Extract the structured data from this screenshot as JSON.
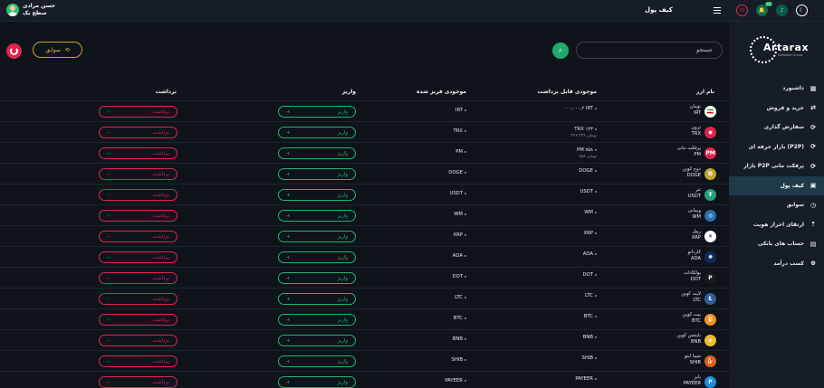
{
  "header": {
    "title": "کیف پول",
    "user_name": "حسن مرادی",
    "user_level": "سطح یک",
    "notification_count": "۳۳"
  },
  "sidebar": {
    "logo": "Artarax",
    "logo_sub": "Software Group",
    "items": [
      {
        "label": "داشبورد",
        "icon": "dashboard-icon"
      },
      {
        "label": "خرید و فروش",
        "icon": "exchange-icon"
      },
      {
        "label": "سفارش گذاری",
        "icon": "refresh-icon"
      },
      {
        "label": "بازار حرفه ای (P2P)",
        "icon": "refresh-icon"
      },
      {
        "label": "بازار P2P پرفکت مانی",
        "icon": "refresh-icon"
      },
      {
        "label": "کیف پول",
        "icon": "wallet-icon",
        "active": true
      },
      {
        "label": "سوابق",
        "icon": "history-icon"
      },
      {
        "label": "ارتقای احراز هویت",
        "icon": "upgrade-icon"
      },
      {
        "label": "حساب های بانکی",
        "icon": "bank-icon"
      },
      {
        "label": "کسب درآمد",
        "icon": "income-icon"
      }
    ]
  },
  "toolbar": {
    "search_placeholder": "جستجو",
    "history_label": "سوابق"
  },
  "table": {
    "headers": {
      "coin": "نام ارز",
      "available": "موجودی قابل برداشت",
      "frozen": "موجودی فریز شده",
      "deposit": "واریز",
      "withdraw": "برداشت"
    },
    "deposit_label": "واریز",
    "withdraw_label": "برداشت",
    "rows": [
      {
        "name": "تومان",
        "symbol": "IRT",
        "available": "۰۰۰,۰۰۰,۲ IRT",
        "available_sub": "",
        "frozen": "IRT",
        "color": "#ffffff",
        "glyph": "🇮🇷"
      },
      {
        "name": "ترون",
        "symbol": "TRX",
        "available": "TRX ۱۲۳",
        "available_sub": "۲۴۶,۳۲۹ تومان",
        "frozen": "TRX",
        "color": "#e0244f",
        "glyph": "◆"
      },
      {
        "name": "پرفکت مانی",
        "symbol": "PM",
        "available": "PM ۷۵۸",
        "available_sub": "۷۵۸ تومان",
        "frozen": "PM",
        "color": "#e0244f",
        "glyph": "PM"
      },
      {
        "name": "دوج کوین",
        "symbol": "DOGE",
        "available": "DOGE",
        "available_sub": "",
        "frozen": "DOGE",
        "color": "#c2a633",
        "glyph": "Ð"
      },
      {
        "name": "تتر",
        "symbol": "USDT",
        "available": "USDT",
        "available_sub": "",
        "frozen": "USDT",
        "color": "#26a17b",
        "glyph": "₮"
      },
      {
        "name": "وبمانی",
        "symbol": "WM",
        "available": "WM",
        "available_sub": "",
        "frozen": "WM",
        "color": "#2a6fb0",
        "glyph": "◎"
      },
      {
        "name": "ریپل",
        "symbol": "XRP",
        "available": "XRP",
        "available_sub": "",
        "frozen": "XRP",
        "color": "#ffffff",
        "glyph": "✕"
      },
      {
        "name": "کاردانو",
        "symbol": "ADA",
        "available": "ADA",
        "available_sub": "",
        "frozen": "ADA",
        "color": "#0d2a5e",
        "glyph": "✺"
      },
      {
        "name": "پولکادات",
        "symbol": "DOT",
        "available": "DOT",
        "available_sub": "",
        "frozen": "DOT",
        "color": "#1a1a1a",
        "glyph": "P"
      },
      {
        "name": "لایت کوین",
        "symbol": "LTC",
        "available": "LTC",
        "available_sub": "",
        "frozen": "LTC",
        "color": "#345d9d",
        "glyph": "Ł"
      },
      {
        "name": "بیت کوین",
        "symbol": "BTC",
        "available": "BTC",
        "available_sub": "",
        "frozen": "BTC",
        "color": "#f7931a",
        "glyph": "₿"
      },
      {
        "name": "بایننس کوین",
        "symbol": "BNB",
        "available": "BNB",
        "available_sub": "",
        "frozen": "BNB",
        "color": "#f3ba2f",
        "glyph": "◈"
      },
      {
        "name": "شیبا اینو",
        "symbol": "SHIB",
        "available": "SHIB",
        "available_sub": "",
        "frozen": "SHIB",
        "color": "#e0621b",
        "glyph": "🐕"
      },
      {
        "name": "پایر",
        "symbol": "PAYEER",
        "available": "PAYEER",
        "available_sub": "",
        "frozen": "PAYEER",
        "color": "#1e8fe0",
        "glyph": "P"
      }
    ]
  }
}
